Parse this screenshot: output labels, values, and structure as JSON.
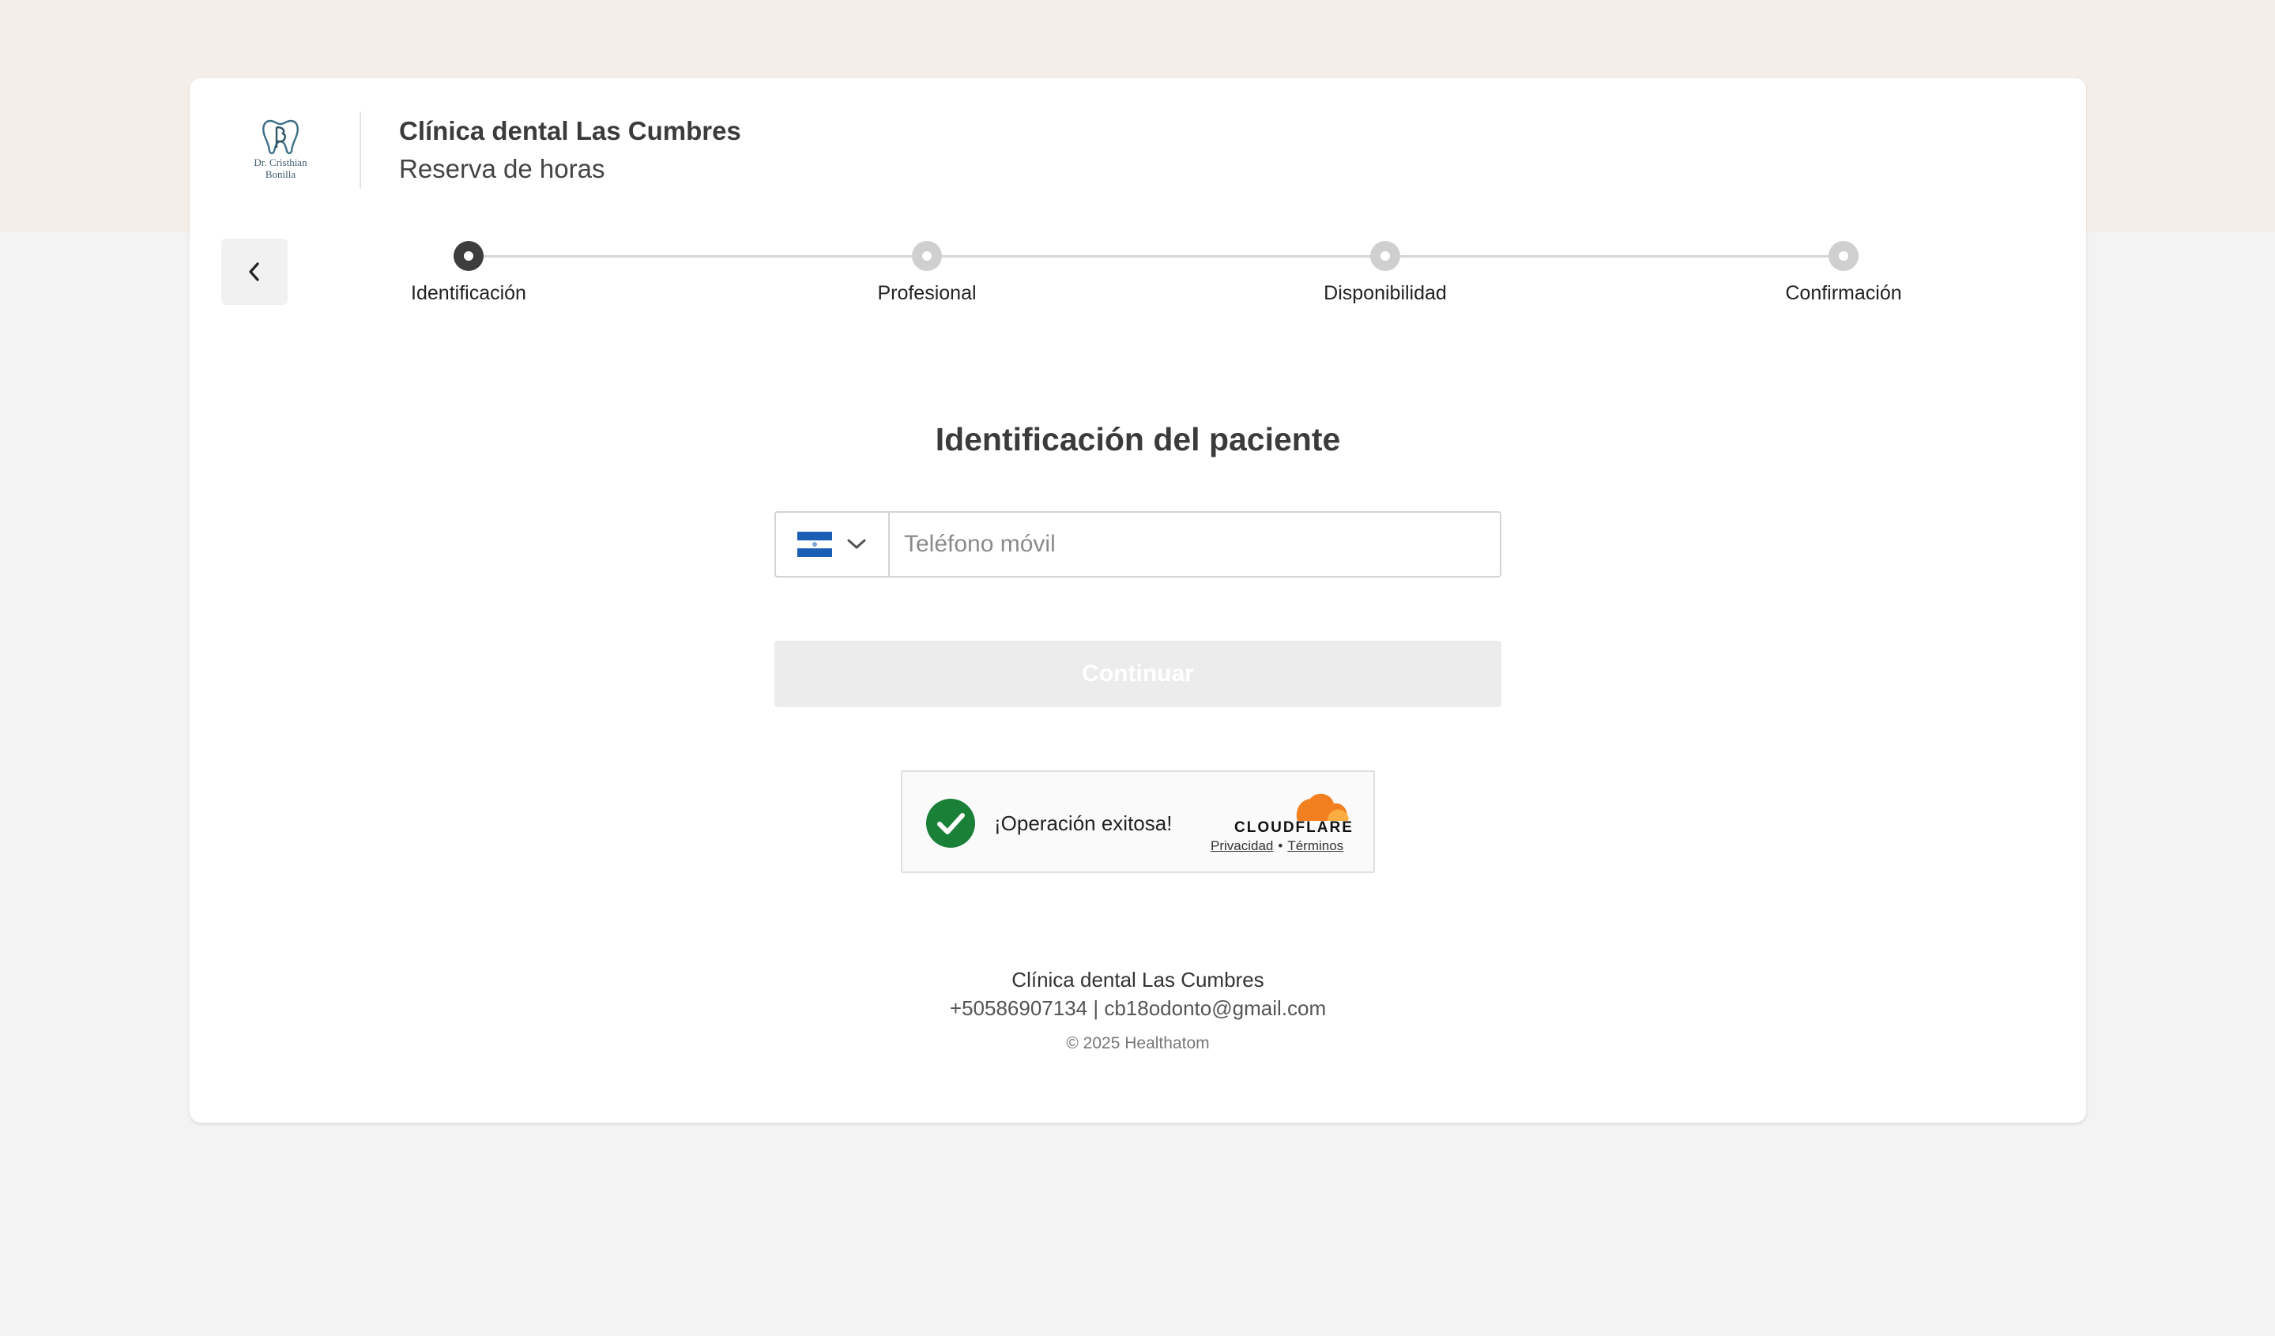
{
  "header": {
    "logo_line1": "Dr. Cristhian",
    "logo_line2": "Bonilla",
    "clinic_name": "Clínica dental Las Cumbres",
    "subtitle": "Reserva de horas"
  },
  "navigation": {
    "back_icon": "chevron-left-icon"
  },
  "stepper": {
    "steps": [
      {
        "label": "Identificación",
        "state": "active"
      },
      {
        "label": "Profesional",
        "state": "inactive"
      },
      {
        "label": "Disponibilidad",
        "state": "inactive"
      },
      {
        "label": "Confirmación",
        "state": "inactive"
      }
    ]
  },
  "main": {
    "title": "Identificación del paciente",
    "phone": {
      "placeholder": "Teléfono móvil",
      "value": "",
      "country_flag": "nicaragua-flag-icon"
    },
    "continue_label": "Continuar"
  },
  "captcha": {
    "status_text": "¡Operación exitosa!",
    "brand": "CLOUDFLARE",
    "privacy_label": "Privacidad",
    "separator": "•",
    "terms_label": "Términos"
  },
  "footer": {
    "name": "Clínica dental Las Cumbres",
    "contact": "+50586907134 | cb18odonto@gmail.com",
    "copyright": "© 2025 Healthatom"
  },
  "colors": {
    "top_band": "#f5ede7",
    "page_bg": "#f3f3f3",
    "card_bg": "#ffffff",
    "step_active": "#3d3d3d",
    "step_inactive": "#cfcfcf",
    "success_green": "#1a7f37",
    "cloudflare_orange": "#f38020"
  }
}
